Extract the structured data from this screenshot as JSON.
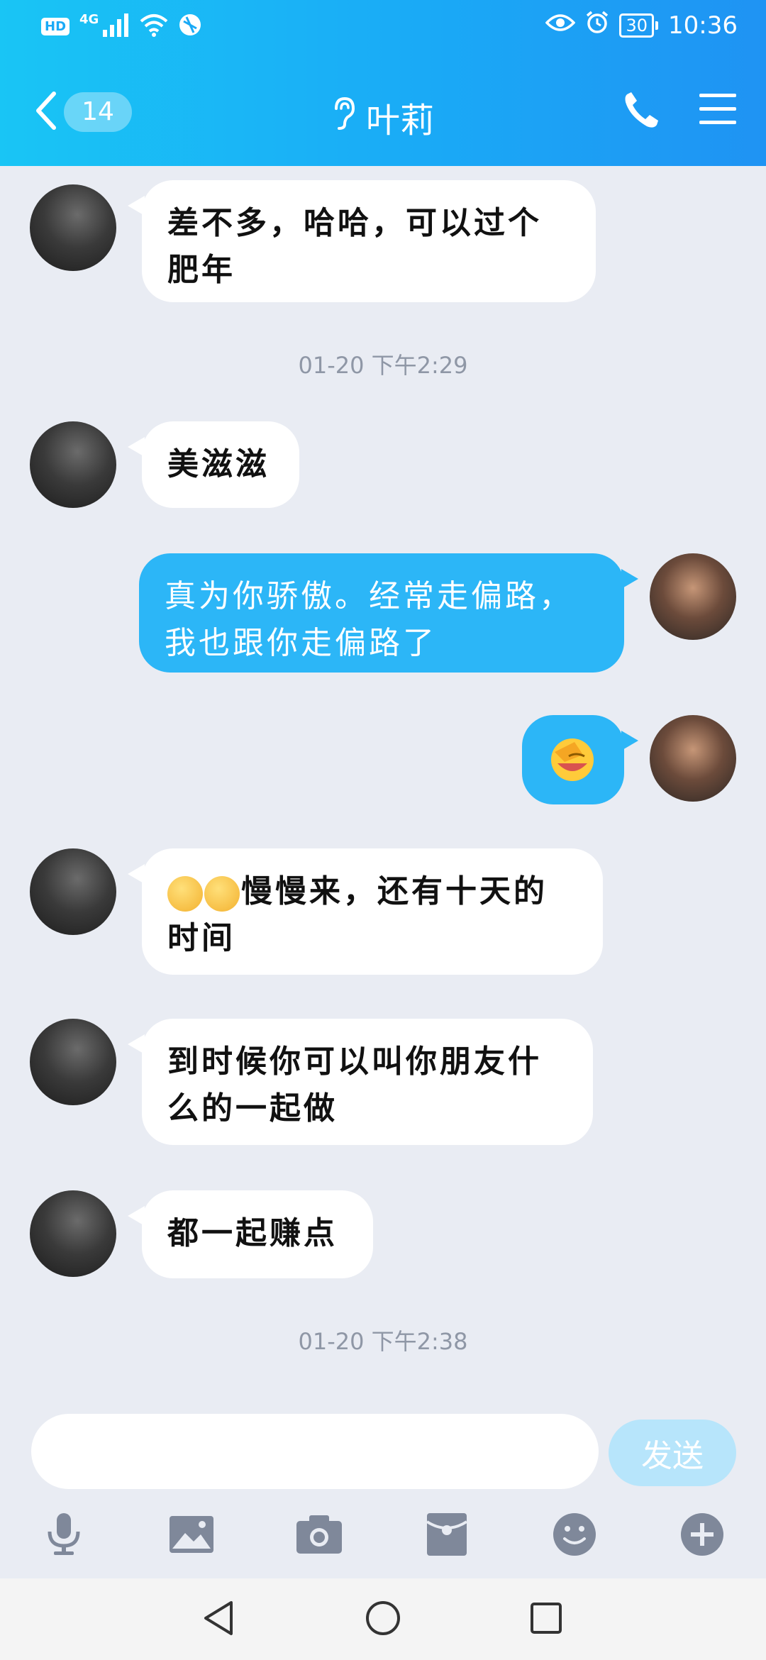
{
  "status_bar": {
    "hd": "HD",
    "network": "4G",
    "battery": "30",
    "time": "10:36"
  },
  "header": {
    "unread_count": "14",
    "title": "叶莉"
  },
  "messages": [
    {
      "direction": "incoming",
      "text": "差不多，哈哈，可以过个肥年"
    },
    {
      "type": "timestamp",
      "text": "01-20 下午2:29"
    },
    {
      "direction": "incoming",
      "text": "美滋滋"
    },
    {
      "direction": "outgoing",
      "text": "真为你骄傲。经常走偏路，我也跟你走偏路了"
    },
    {
      "direction": "outgoing",
      "icon": "facepalm-emoji"
    },
    {
      "direction": "incoming",
      "text": "慢慢来，还有十天的时间",
      "icons": [
        "yawn-emoji",
        "yawn-emoji"
      ]
    },
    {
      "direction": "incoming",
      "text": "到时候你可以叫你朋友什么的一起做"
    },
    {
      "direction": "incoming",
      "text": "都一起赚点"
    },
    {
      "type": "timestamp",
      "text": "01-20 下午2:38"
    }
  ],
  "input": {
    "value": "",
    "send_label": "发送"
  },
  "toolbar": [
    "microphone-icon",
    "image-icon",
    "camera-icon",
    "red-packet-icon",
    "emoji-icon",
    "plus-icon"
  ],
  "colors": {
    "header_gradient_start": "#19c5f5",
    "header_gradient_end": "#1f93f3",
    "outgoing_bubble": "#2cb6f7",
    "background": "#e9ecf3",
    "send_button": "#b7e5fb"
  }
}
